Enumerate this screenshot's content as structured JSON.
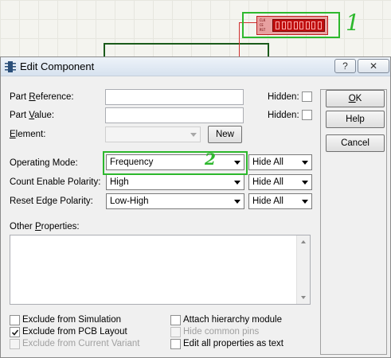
{
  "annotations": {
    "mark_1": "1",
    "mark_2": "2"
  },
  "schematic": {
    "pin_labels": [
      "CLK",
      "CE",
      "RST"
    ]
  },
  "dialog": {
    "title": "Edit Component",
    "help_glyph": "?",
    "close_glyph": "✕",
    "fields": {
      "part_reference": {
        "pre": "Part ",
        "key": "R",
        "post": "eference:",
        "value": ""
      },
      "part_value": {
        "pre": "Part ",
        "key": "V",
        "post": "alue:",
        "value": ""
      },
      "element": {
        "pre": "",
        "key": "E",
        "post": "lement:",
        "value": ""
      },
      "hidden_label": "Hidden:",
      "new_button": "New"
    },
    "selects": {
      "operating_mode": {
        "label": "Operating Mode:",
        "value": "Frequency",
        "visibility": "Hide All"
      },
      "count_enable_polarity": {
        "label": "Count Enable Polarity:",
        "value": "High",
        "visibility": "Hide All"
      },
      "reset_edge_polarity": {
        "label": "Reset Edge Polarity:",
        "value": "Low-High",
        "visibility": "Hide All"
      }
    },
    "other_properties": {
      "pre": "Other ",
      "key": "P",
      "post": "roperties:",
      "value": ""
    },
    "options": {
      "exclude_from_simulation": {
        "label": "Exclude from Simulation",
        "checked": false
      },
      "exclude_from_pcb_layout": {
        "label": "Exclude from PCB Layout",
        "checked": true
      },
      "exclude_from_current_variant": {
        "label": "Exclude from Current Variant",
        "checked": false,
        "disabled": true
      },
      "attach_hierarchy_module": {
        "label": "Attach hierarchy module",
        "checked": false
      },
      "hide_common_pins": {
        "label": "Hide common pins",
        "checked": false,
        "disabled": true
      },
      "edit_all_properties": {
        "label": "Edit all properties as text",
        "checked": false
      }
    },
    "buttons": {
      "ok": {
        "pre": "",
        "key": "O",
        "post": "K"
      },
      "help": "Help",
      "cancel": "Cancel"
    }
  },
  "colors": {
    "annotation_green": "#2db82d",
    "component_red": "#c01010"
  }
}
